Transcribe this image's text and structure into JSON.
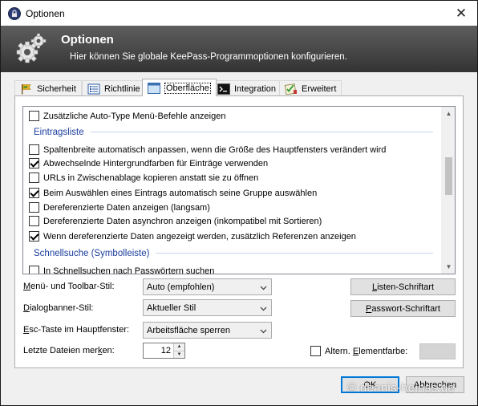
{
  "window": {
    "title": "Optionen",
    "close_glyph": "✕"
  },
  "banner": {
    "title": "Optionen",
    "subtitle": "Hier können Sie globale KeePass-Programmoptionen konfigurieren.",
    "icon": "gears-icon"
  },
  "tabs": [
    {
      "label": "Sicherheit",
      "icon": "security-flag-icon",
      "active": false
    },
    {
      "label": "Richtlinie",
      "icon": "policy-list-icon",
      "active": false
    },
    {
      "label": "Oberfläche",
      "icon": "interface-window-icon",
      "active": true
    },
    {
      "label": "Integration",
      "icon": "terminal-icon",
      "active": false
    },
    {
      "label": "Erweitert",
      "icon": "advanced-checklist-icon",
      "active": false
    }
  ],
  "list": {
    "items": [
      {
        "type": "option",
        "label": "Zusätzliche Auto-Type Menü-Befehle anzeigen",
        "checked": false
      },
      {
        "type": "group",
        "label": "Eintragsliste"
      },
      {
        "type": "option",
        "label": "Spaltenbreite automatisch anpassen, wenn die Größe des Hauptfensters verändert wird",
        "checked": false
      },
      {
        "type": "option",
        "label": "Abwechselnde Hintergrundfarben für Einträge verwenden",
        "checked": true
      },
      {
        "type": "option",
        "label": "URLs in Zwischenablage kopieren anstatt sie zu öffnen",
        "checked": false
      },
      {
        "type": "option",
        "label": "Beim Auswählen eines Eintrags automatisch seine Gruppe auswählen",
        "checked": true
      },
      {
        "type": "option",
        "label": "Dereferenzierte Daten anzeigen (langsam)",
        "checked": false
      },
      {
        "type": "option",
        "label": "Dereferenzierte Daten asynchron anzeigen (inkompatibel mit Sortieren)",
        "checked": false
      },
      {
        "type": "option",
        "label": "Wenn dereferenzierte Daten angezeigt werden, zusätzlich Referenzen anzeigen",
        "checked": true
      },
      {
        "type": "group",
        "label": "Schnellsuche (Symbolleiste)"
      },
      {
        "type": "option",
        "label": "In Schnellsuchen nach Passwörtern suchen",
        "checked": false
      }
    ]
  },
  "settings": {
    "menu_style": {
      "label_pre": "",
      "label_key": "M",
      "label_post": "enü- und Toolbar-Stil:",
      "value": "Auto (empfohlen)"
    },
    "banner_style": {
      "label_pre": "",
      "label_key": "D",
      "label_post": "ialogbanner-Stil:",
      "value": "Aktueller Stil"
    },
    "esc_key": {
      "label_pre": "",
      "label_key": "E",
      "label_post": "sc-Taste im Hauptfenster:",
      "value": "Arbeitsfläche sperren"
    },
    "recent_files": {
      "label_pre": "Letzte Dateien mer",
      "label_key": "k",
      "label_post": "en:",
      "value": "12"
    }
  },
  "buttons": {
    "list_font": {
      "pre": "",
      "key": "L",
      "post": "isten-Schriftart"
    },
    "password_font": {
      "pre": "",
      "key": "P",
      "post": "asswort-Schriftart"
    },
    "ok": "OK",
    "cancel": "Abbrechen"
  },
  "alt_color": {
    "label_pre": "Altern. ",
    "label_key": "E",
    "label_post": "lementfarbe:",
    "checked": false
  },
  "watermark": "© dennis-heinss.de",
  "colors": {
    "banner_top": "#5e5e5e",
    "banner_bottom": "#333333",
    "group_header": "#1a3d9e",
    "default_button_border": "#0078d7"
  }
}
